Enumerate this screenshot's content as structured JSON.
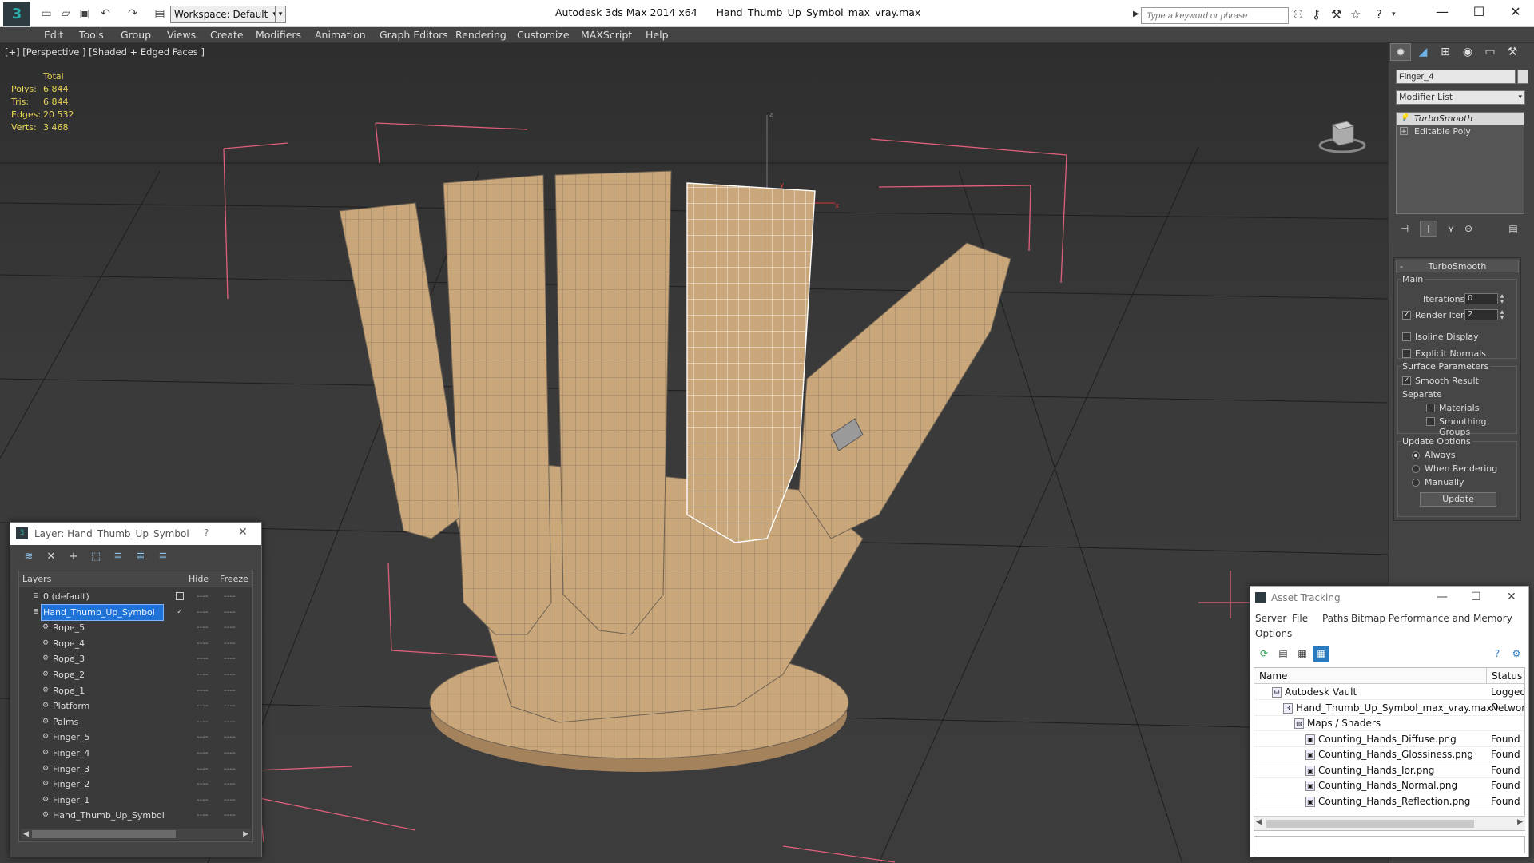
{
  "app": {
    "title": "Autodesk 3ds Max  2014 x64",
    "file": "Hand_Thumb_Up_Symbol_max_vray.max",
    "workspace": "Workspace: Default",
    "search_placeholder": "Type a keyword or phrase"
  },
  "menubar": [
    "Edit",
    "Tools",
    "Group",
    "Views",
    "Create",
    "Modifiers",
    "Animation",
    "Graph Editors",
    "Rendering",
    "Customize",
    "MAXScript",
    "Help"
  ],
  "viewport": {
    "label": "[+] [Perspective ] [Shaded + Edged Faces ]",
    "stats": {
      "header": "Total",
      "rows": [
        {
          "label": "Polys:",
          "value": "6 844"
        },
        {
          "label": "Tris:",
          "value": "6 844"
        },
        {
          "label": "Edges:",
          "value": "20 532"
        },
        {
          "label": "Verts:",
          "value": "3 468"
        }
      ]
    },
    "axis": {
      "x": "x",
      "y": "y",
      "z": "z"
    },
    "colors": {
      "bbox": "#e0607a",
      "wood": "#c9a77a",
      "wire": "#6e6152",
      "selected_wire": "#ffffff"
    }
  },
  "command_panel": {
    "object_name": "Finger_4",
    "modifier_list": "Modifier List",
    "stack": [
      "TurboSmooth",
      "Editable Poly"
    ],
    "rollout": {
      "title": "TurboSmooth",
      "main_label": "Main",
      "iterations_label": "Iterations:",
      "iterations_value": "0",
      "render_iters_label": "Render Iters:",
      "render_iters_value": "2",
      "render_iters_checked": true,
      "isoline_label": "Isoline Display",
      "explicit_normals_label": "Explicit Normals",
      "surface_params_label": "Surface Parameters",
      "smooth_result_label": "Smooth Result",
      "separate_label": "Separate",
      "materials_label": "Materials",
      "smoothing_groups_label": "Smoothing Groups",
      "update_options_label": "Update Options",
      "always_label": "Always",
      "when_rendering_label": "When Rendering",
      "manually_label": "Manually",
      "update_button": "Update"
    }
  },
  "layer_window": {
    "title": "Layer: Hand_Thumb_Up_Symbol",
    "help": "?",
    "columns": {
      "layers": "Layers",
      "hide": "Hide",
      "freeze": "Freeze"
    },
    "rows": [
      {
        "name": "0 (default)",
        "level": 0,
        "type": "layer"
      },
      {
        "name": "Hand_Thumb_Up_Symbol",
        "level": 0,
        "type": "layer",
        "selected": true
      },
      {
        "name": "Rope_5",
        "level": 1,
        "type": "obj"
      },
      {
        "name": "Rope_4",
        "level": 1,
        "type": "obj"
      },
      {
        "name": "Rope_3",
        "level": 1,
        "type": "obj"
      },
      {
        "name": "Rope_2",
        "level": 1,
        "type": "obj"
      },
      {
        "name": "Rope_1",
        "level": 1,
        "type": "obj"
      },
      {
        "name": "Platform",
        "level": 1,
        "type": "obj"
      },
      {
        "name": "Palms",
        "level": 1,
        "type": "obj"
      },
      {
        "name": "Finger_5",
        "level": 1,
        "type": "obj"
      },
      {
        "name": "Finger_4",
        "level": 1,
        "type": "obj"
      },
      {
        "name": "Finger_3",
        "level": 1,
        "type": "obj"
      },
      {
        "name": "Finger_2",
        "level": 1,
        "type": "obj"
      },
      {
        "name": "Finger_1",
        "level": 1,
        "type": "obj"
      },
      {
        "name": "Hand_Thumb_Up_Symbol",
        "level": 1,
        "type": "obj"
      }
    ],
    "dash": "----"
  },
  "asset_window": {
    "title": "Asset Tracking",
    "menu": [
      "Server",
      "File",
      "Paths",
      "Bitmap Performance and Memory",
      "Options"
    ],
    "columns": {
      "name": "Name",
      "status": "Status"
    },
    "rows": [
      {
        "name": "Autodesk Vault",
        "status": "Logged O",
        "level": 0
      },
      {
        "name": "Hand_Thumb_Up_Symbol_max_vray.max",
        "status": "Network",
        "level": 1
      },
      {
        "name": "Maps / Shaders",
        "status": "",
        "level": 2
      },
      {
        "name": "Counting_Hands_Diffuse.png",
        "status": "Found",
        "level": 3
      },
      {
        "name": "Counting_Hands_Glossiness.png",
        "status": "Found",
        "level": 3
      },
      {
        "name": "Counting_Hands_Ior.png",
        "status": "Found",
        "level": 3
      },
      {
        "name": "Counting_Hands_Normal.png",
        "status": "Found",
        "level": 3
      },
      {
        "name": "Counting_Hands_Reflection.png",
        "status": "Found",
        "level": 3
      }
    ]
  }
}
